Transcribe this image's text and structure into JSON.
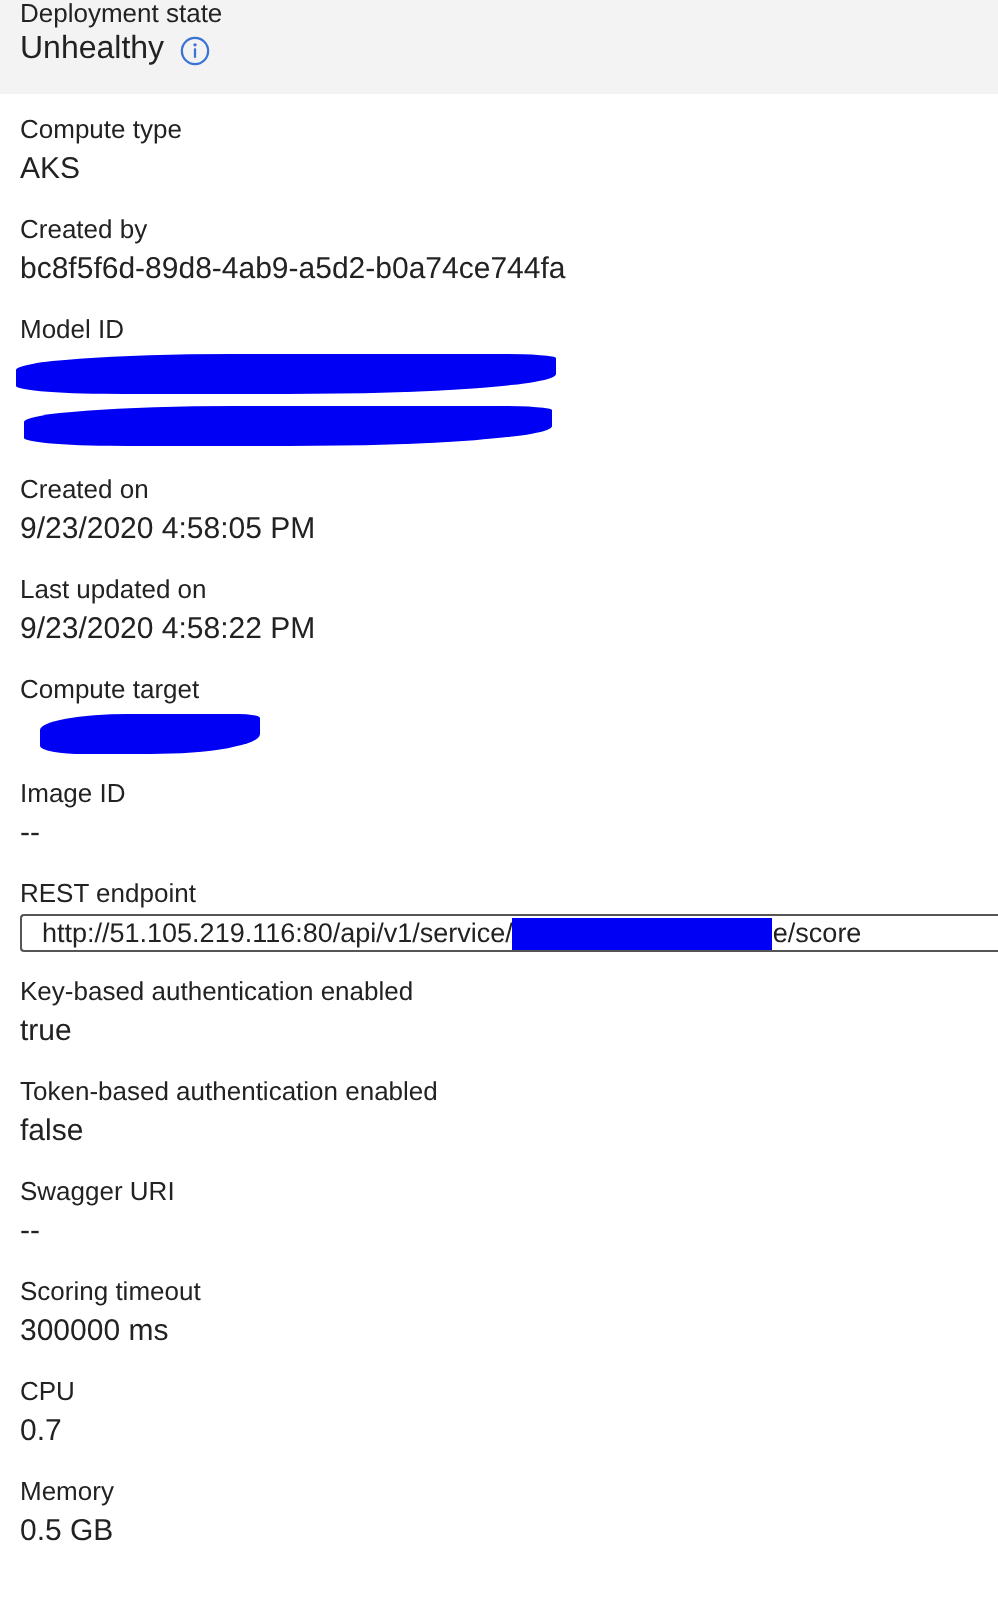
{
  "status": {
    "label": "Deployment state",
    "value": "Unhealthy"
  },
  "fields": [
    {
      "kind": "text",
      "label": "Compute type",
      "value": "AKS"
    },
    {
      "kind": "text",
      "label": "Created by",
      "value": "bc8f5f6d-89d8-4ab9-a5d2-b0a74ce744fa"
    },
    {
      "kind": "redacted_link",
      "label": "Model ID"
    },
    {
      "kind": "text",
      "label": "Created on",
      "value": "9/23/2020 4:58:05 PM"
    },
    {
      "kind": "text",
      "label": "Last updated on",
      "value": "9/23/2020 4:58:22 PM"
    },
    {
      "kind": "redacted",
      "label": "Compute target"
    },
    {
      "kind": "text",
      "label": "Image ID",
      "value": "--"
    },
    {
      "kind": "endpoint",
      "label": "REST endpoint",
      "prefix": "http://51.105.219.116:80/api/v1/service/",
      "suffix": "e/score"
    },
    {
      "kind": "text",
      "label": "Key-based authentication enabled",
      "value": "true"
    },
    {
      "kind": "text",
      "label": "Token-based authentication enabled",
      "value": "false"
    },
    {
      "kind": "text",
      "label": "Swagger URI",
      "value": "--"
    },
    {
      "kind": "text",
      "label": "Scoring timeout",
      "value": "300000 ms"
    },
    {
      "kind": "text",
      "label": "CPU",
      "value": "0.7"
    },
    {
      "kind": "text",
      "label": "Memory",
      "value": "0.5 GB"
    }
  ]
}
